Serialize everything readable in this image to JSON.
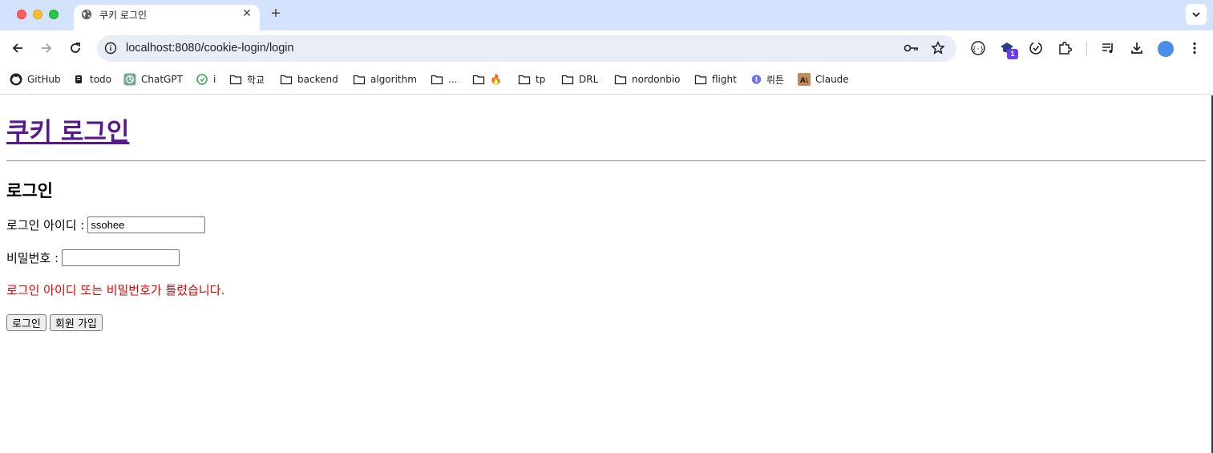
{
  "browser": {
    "tab_title": "쿠키 로그인",
    "url": "localhost:8080/cookie-login/login",
    "extension_badge": "1"
  },
  "bookmarks": [
    {
      "label": "GitHub",
      "icon": "github-icon"
    },
    {
      "label": "todo",
      "icon": "todo-icon"
    },
    {
      "label": "ChatGPT",
      "icon": "chatgpt-icon"
    },
    {
      "label": "i",
      "icon": "green-circle-icon"
    },
    {
      "label": "학교",
      "icon": "folder-icon"
    },
    {
      "label": "backend",
      "icon": "folder-icon"
    },
    {
      "label": "algorithm",
      "icon": "folder-icon"
    },
    {
      "label": "...",
      "icon": "folder-icon"
    },
    {
      "label": "🔥",
      "icon": "folder-icon"
    },
    {
      "label": "tp",
      "icon": "folder-icon"
    },
    {
      "label": "DRL",
      "icon": "folder-icon"
    },
    {
      "label": "nordonbio",
      "icon": "folder-icon"
    },
    {
      "label": "flight",
      "icon": "folder-icon"
    },
    {
      "label": "뤼튼",
      "icon": "wrtn-icon"
    },
    {
      "label": "Claude",
      "icon": "claude-icon"
    }
  ],
  "page": {
    "site_title": "쿠키 로그인",
    "heading": "로그인",
    "login_id_label": "로그인 아이디 :",
    "login_id_value": "ssohee",
    "password_label": "비밀번호 :",
    "password_value": "",
    "error_message": "로그인 아이디 또는 비밀번호가 틀렸습니다.",
    "login_button": "로그인",
    "signup_button": "회원 가입"
  },
  "colors": {
    "tabstrip": "#d3e3fd",
    "link_visited": "#551a8b",
    "error": "#e00000"
  }
}
